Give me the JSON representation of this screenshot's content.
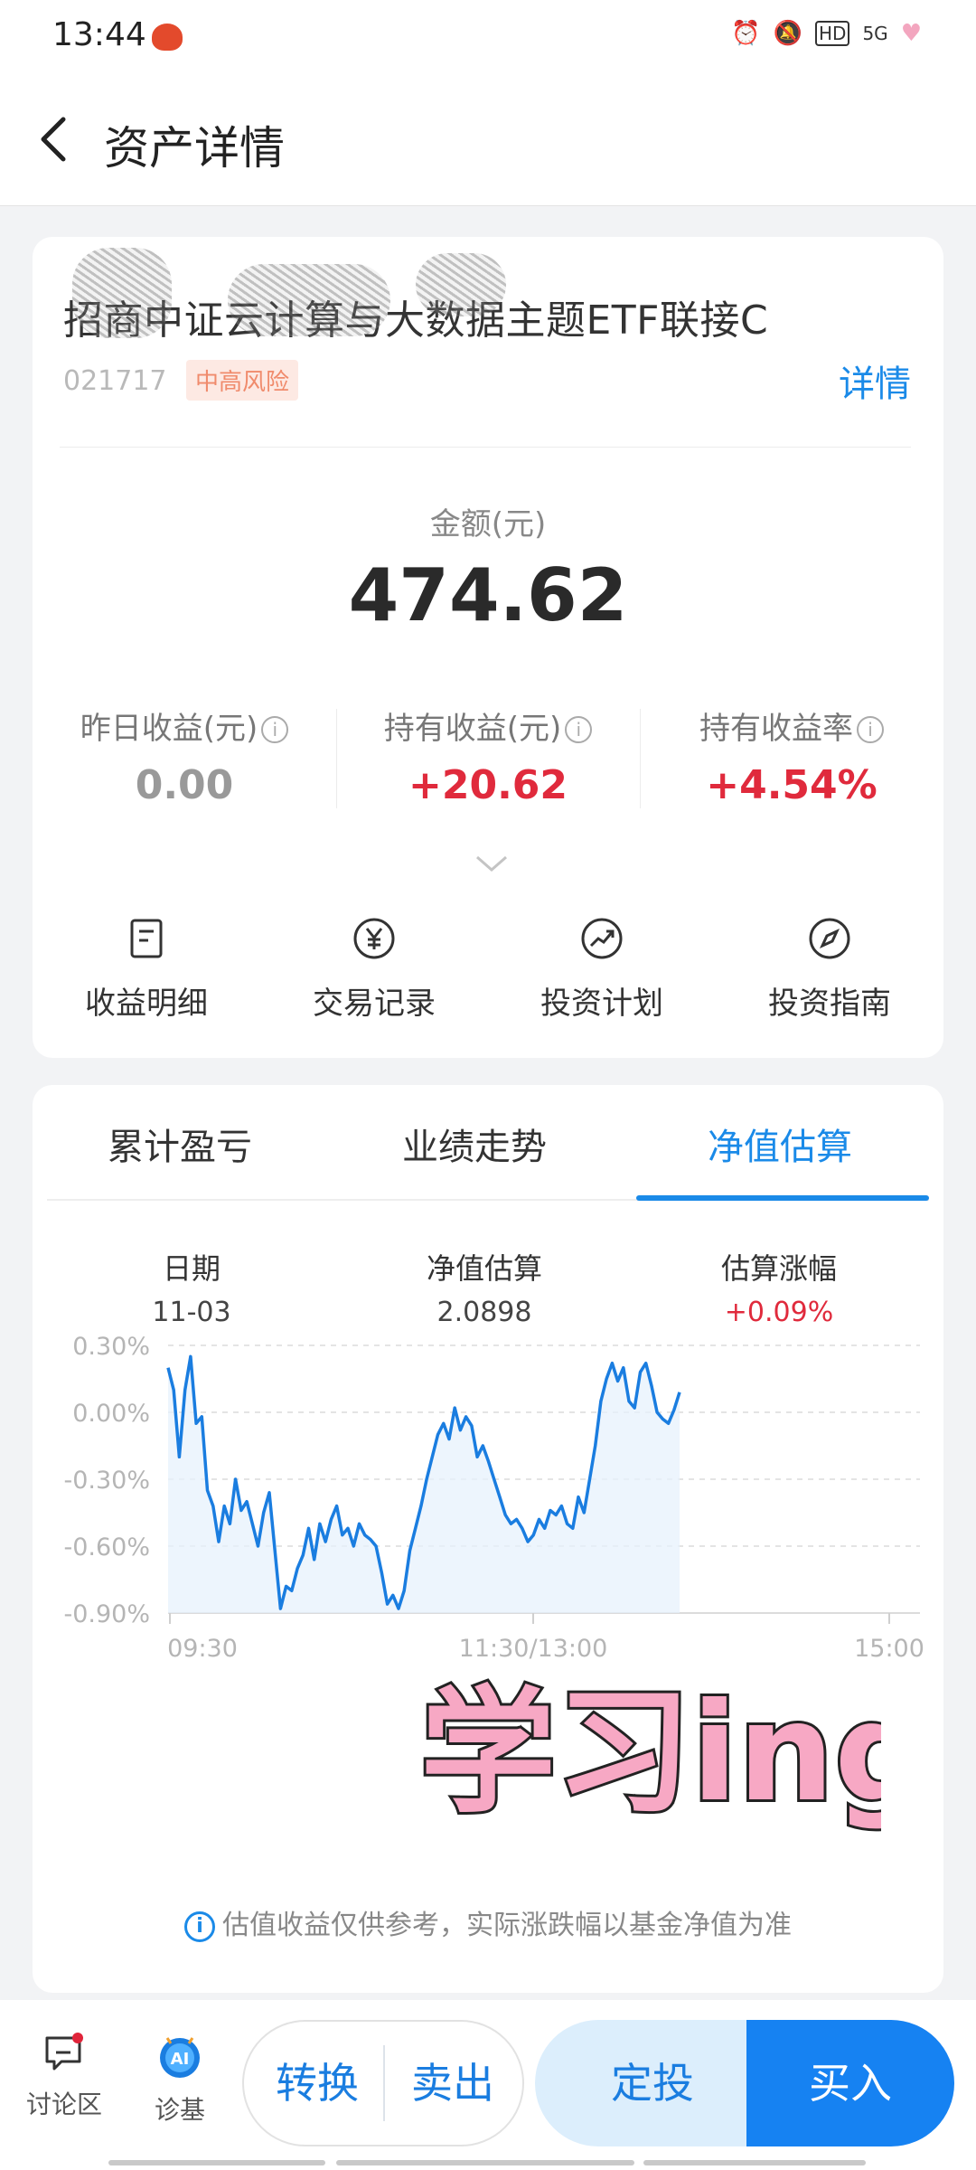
{
  "status_bar": {
    "time": "13:44",
    "signal": "5G",
    "hd": "HD"
  },
  "header": {
    "title": "资产详情"
  },
  "fund": {
    "name": "招商中证云计算与大数据主题ETF联接C",
    "code": "021717",
    "risk": "中高风险",
    "detail_link": "详情"
  },
  "amount": {
    "label": "金额(元)",
    "value": "474.62"
  },
  "stats": [
    {
      "label": "昨日收益(元)",
      "value": "0.00",
      "color": "#999999"
    },
    {
      "label": "持有收益(元)",
      "value": "+20.62",
      "color": "#e02a3c"
    },
    {
      "label": "持有收益率",
      "value": "+4.54%",
      "color": "#e02a3c"
    }
  ],
  "actions": [
    {
      "label": "收益明细",
      "icon": "document-icon"
    },
    {
      "label": "交易记录",
      "icon": "yuan-icon"
    },
    {
      "label": "投资计划",
      "icon": "trend-icon"
    },
    {
      "label": "投资指南",
      "icon": "compass-icon"
    }
  ],
  "tabs": [
    "累计盈亏",
    "业绩走势",
    "净值估算"
  ],
  "active_tab": 2,
  "estimate": {
    "date_label": "日期",
    "date_value": "11-03",
    "nav_label": "净值估算",
    "nav_value": "2.0898",
    "change_label": "估算涨幅",
    "change_value": "+0.09%"
  },
  "chart_data": {
    "type": "line",
    "y_ticks": [
      "0.30%",
      "0.00%",
      "-0.30%",
      "-0.60%",
      "-0.90%"
    ],
    "ylim": [
      -0.9,
      0.3
    ],
    "x_ticks": [
      "09:30",
      "11:30/13:00",
      "15:00"
    ],
    "series": [
      {
        "color": "#1a7de0",
        "values": [
          0.2,
          0.1,
          -0.2,
          0.1,
          0.25,
          -0.05,
          -0.02,
          -0.35,
          -0.42,
          -0.58,
          -0.42,
          -0.5,
          -0.3,
          -0.44,
          -0.4,
          -0.5,
          -0.6,
          -0.45,
          -0.36,
          -0.62,
          -0.88,
          -0.78,
          -0.8,
          -0.7,
          -0.64,
          -0.52,
          -0.66,
          -0.5,
          -0.58,
          -0.48,
          -0.42,
          -0.55,
          -0.52,
          -0.6,
          -0.5,
          -0.55,
          -0.57,
          -0.6,
          -0.72,
          -0.86,
          -0.82,
          -0.88,
          -0.8,
          -0.62,
          -0.52,
          -0.42,
          -0.3,
          -0.2,
          -0.1,
          -0.05,
          -0.12,
          0.02,
          -0.08,
          -0.02,
          -0.06,
          -0.2,
          -0.15,
          -0.22,
          -0.3,
          -0.38,
          -0.46,
          -0.5,
          -0.48,
          -0.52,
          -0.58,
          -0.55,
          -0.48,
          -0.52,
          -0.44,
          -0.46,
          -0.42,
          -0.5,
          -0.52,
          -0.38,
          -0.45,
          -0.3,
          -0.15,
          0.05,
          0.15,
          0.22,
          0.14,
          0.2,
          0.05,
          0.02,
          0.18,
          0.22,
          0.12,
          0.0,
          -0.03,
          -0.05,
          0.01,
          0.09
        ]
      }
    ]
  },
  "disclaimer": "估值收益仅供参考，实际涨跌幅以基金净值为准",
  "bottom_bar": {
    "discuss": "讨论区",
    "diagnose": "诊基",
    "convert": "转换",
    "sell": "卖出",
    "fixed": "定投",
    "buy": "买入"
  },
  "sticker_text": "学习ing"
}
